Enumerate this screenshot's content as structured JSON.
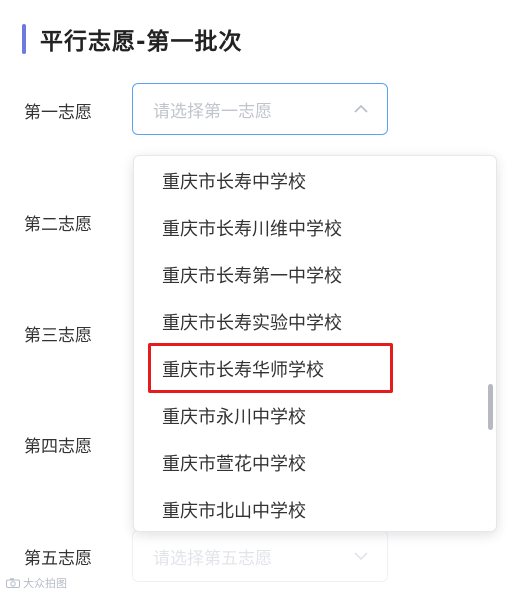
{
  "section": {
    "title": "平行志愿-第一批次"
  },
  "rows": [
    {
      "label": "第一志愿",
      "placeholder": "请选择第一志愿"
    },
    {
      "label": "第二志愿"
    },
    {
      "label": "第三志愿"
    },
    {
      "label": "第四志愿"
    },
    {
      "label": "第五志愿",
      "placeholder": "请选择第五志愿"
    }
  ],
  "dropdown": {
    "options": [
      "重庆市长寿中学校",
      "重庆市长寿川维中学校",
      "重庆市长寿第一中学校",
      "重庆市长寿实验中学校",
      "重庆市长寿华师学校",
      "重庆市永川中学校",
      "重庆市萱花中学校",
      "重庆市北山中学校"
    ],
    "highlighted_option": "重庆市长寿华师学校",
    "highlight_color": "#e41c1c"
  },
  "icons": {
    "open_arrow": "chevron-up-icon",
    "closed_arrow": "chevron-down-icon"
  },
  "colors": {
    "title_accent": "#6c7ae0",
    "active_border": "#59a3f5"
  },
  "watermark": {
    "text": "大众拍图"
  }
}
